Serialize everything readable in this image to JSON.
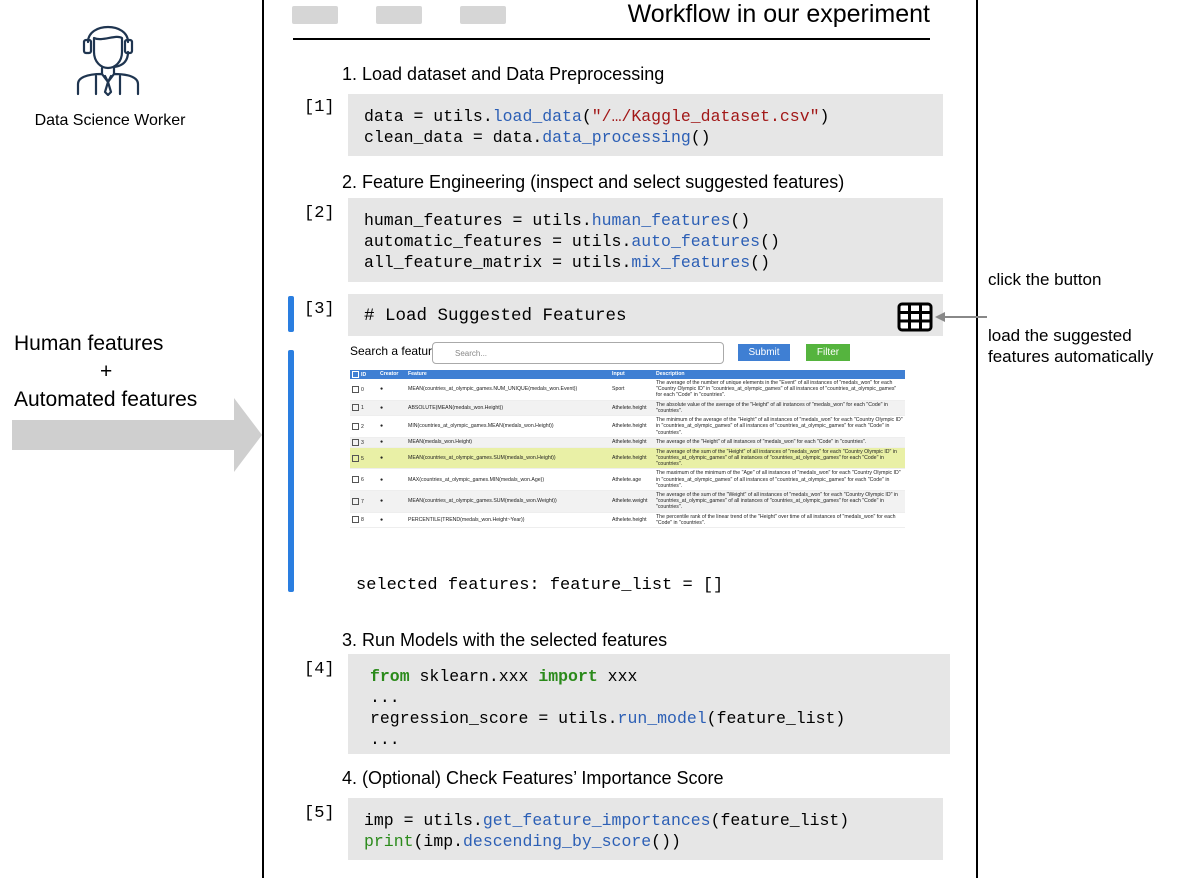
{
  "notebook": {
    "title": "Workflow in our experiment"
  },
  "left": {
    "worker_label": "Data Science Worker",
    "features_line1": "Human features",
    "features_plus": "+",
    "features_line2": "Automated features"
  },
  "right": {
    "click_note": "click the button",
    "load_note_line1": "load the suggested",
    "load_note_line2": "features automatically"
  },
  "steps": {
    "s1": "1. Load dataset and Data Preprocessing",
    "s2": "2. Feature Engineering (inspect and select suggested features)",
    "s3": "3. Run Models with the selected features",
    "s4": "4. (Optional) Check Features’ Importance Score"
  },
  "cells": {
    "c1": {
      "num": "[1]",
      "l1_a": "data = utils.",
      "l1_fn": "load_data",
      "l1_b": "(",
      "l1_str": "\"/…/Kaggle_dataset.csv\"",
      "l1_c": ")",
      "l2_a": "clean_data = data.",
      "l2_fn": "data_processing",
      "l2_b": "()"
    },
    "c2": {
      "num": "[2]",
      "l1_a": "human_features = utils.",
      "l1_fn": "human_features",
      "l1_b": "()",
      "l2_a": "automatic_features = utils.",
      "l2_fn": "auto_features",
      "l2_b": "()",
      "l3_a": "all_feature_matrix = utils.",
      "l3_fn": "mix_features",
      "l3_b": "()"
    },
    "c3": {
      "num": "[3]",
      "code": "# Load Suggested Features",
      "selected": "selected features: feature_list = []"
    },
    "c4": {
      "num": "[4]",
      "l1_kw1": "from",
      "l1_mid": " sklearn.xxx ",
      "l1_kw2": "import",
      "l1_end": " xxx",
      "l2": "...",
      "l3_a": "regression_score = utils.",
      "l3_fn": "run_model",
      "l3_b": "(feature_list)",
      "l4": "..."
    },
    "c5": {
      "num": "[5]",
      "l1_a": "imp = utils.",
      "l1_fn": "get_feature_importances",
      "l1_b": "(feature_list)",
      "l2_fn1": "print",
      "l2_a": "(imp.",
      "l2_fn2": "descending_by_score",
      "l2_b": "())"
    }
  },
  "widget": {
    "search_label": "Search a feature",
    "search_placeholder": "Search...",
    "submit_label": "Submit",
    "filter_label": "Filter",
    "columns": [
      "ID",
      "Creator",
      "Feature",
      "Input",
      "Description"
    ],
    "rows": [
      {
        "id": "0",
        "feature": "MEAN(countries_at_olympic_games.NUM_UNIQUE(medals_won.Event))",
        "input": "Sport",
        "desc": "The average of the number of unique elements in the \"Event\" of all instances of \"medals_won\" for each \"Country Olympic ID\" in \"countries_at_olympic_games\" of all instances of \"countries_at_olympic_games\" for each \"Code\" in \"countries\"."
      },
      {
        "id": "1",
        "feature": "ABSOLUTE(MEAN(medals_won.Height))",
        "input": "Athelete.height",
        "desc": "The absolute value of the average of the \"Height\" of all instances of \"medals_won\" for each \"Code\" in \"countries\"."
      },
      {
        "id": "2",
        "feature": "MIN(countries_at_olympic_games.MEAN(medals_won.Height))",
        "input": "Athelete.height",
        "desc": "The minimum of the average of the \"Height\" of all instances of \"medals_won\" for each \"Country Olympic ID\" in \"countries_at_olympic_games\" of all instances of \"countries_at_olympic_games\" for each \"Code\" in \"countries\"."
      },
      {
        "id": "3",
        "feature": "MEAN(medals_won.Height)",
        "input": "Athelete.height",
        "desc": "The average of the \"Height\" of all instances of \"medals_won\" for each \"Code\" in \"countries\"."
      },
      {
        "id": "5",
        "feature": "MEAN(countries_at_olympic_games.SUM(medals_won.Height))",
        "input": "Athelete.height",
        "desc": "The average of the sum of the \"Height\" of all instances of \"medals_won\" for each \"Country Olympic ID\" in \"countries_at_olympic_games\" of all instances of \"countries_at_olympic_games\" for each \"Code\" in \"countries\"."
      },
      {
        "id": "6",
        "feature": "MAX(countries_at_olympic_games.MIN(medals_won.Age))",
        "input": "Athelete.age",
        "desc": "The maximum of the minimum of the \"Age\" of all instances of \"medals_won\" for each \"Country Olympic ID\" in \"countries_at_olympic_games\" of all instances of \"countries_at_olympic_games\" for each \"Code\" in \"countries\"."
      },
      {
        "id": "7",
        "feature": "MEAN(countries_at_olympic_games.SUM(medals_won.Weight))",
        "input": "Athelete.weight",
        "desc": "The average of the sum of the \"Weight\" of all instances of \"medals_won\" for each \"Country Olympic ID\" in \"countries_at_olympic_games\" of all instances of \"countries_at_olympic_games\" for each \"Code\" in \"countries\"."
      },
      {
        "id": "8",
        "feature": "PERCENTILE(TREND(medals_won.Height~Year))",
        "input": "Athelete.height",
        "desc": "The percentile rank of the linear trend of the \"Height\" over time of all instances of \"medals_won\" for each \"Code\" in \"countries\"."
      }
    ]
  },
  "colors": {
    "function": "#2c5fb5",
    "string": "#a21818",
    "keyword": "#2a8a1a",
    "cell_bg": "#e6e6e6",
    "active_bar": "#2a7ee0",
    "highlight_row": "#e9f0a6"
  }
}
